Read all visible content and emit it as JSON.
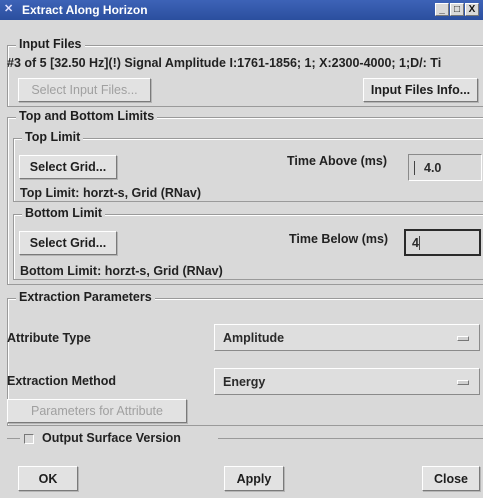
{
  "window": {
    "title": "Extract Along Horizon",
    "icon": "app-icon",
    "controls": [
      "_",
      "□",
      "X"
    ]
  },
  "input_files": {
    "group_title": "Input Files",
    "info_text": "#3 of 5 [32.50 Hz](!) Signal Amplitude I:1761-1856; 1; X:2300-4000; 1;D/: Ti",
    "select_button": "Select Input Files...",
    "info_button": "Input Files Info..."
  },
  "limits": {
    "group_title": "Top and Bottom Limits",
    "top": {
      "group_title": "Top Limit",
      "select_button": "Select Grid...",
      "time_label": "Time Above (ms)",
      "time_value": "4.0",
      "limit_text": "Top Limit: horzt-s, Grid (RNav)"
    },
    "bottom": {
      "group_title": "Bottom Limit",
      "select_button": "Select Grid...",
      "time_label": "Time Below (ms)",
      "time_value": "4",
      "limit_text": "Bottom Limit: horzt-s, Grid (RNav)"
    }
  },
  "extraction": {
    "group_title": "Extraction Parameters",
    "attribute_type_label": "Attribute Type",
    "attribute_type_value": "Amplitude",
    "method_label": "Extraction Method",
    "method_value": "Energy",
    "params_button": "Parameters for Attribute"
  },
  "output": {
    "checkbox_label": "Output Surface Version",
    "checked": false
  },
  "footer": {
    "ok": "OK",
    "apply": "Apply",
    "close": "Close"
  }
}
